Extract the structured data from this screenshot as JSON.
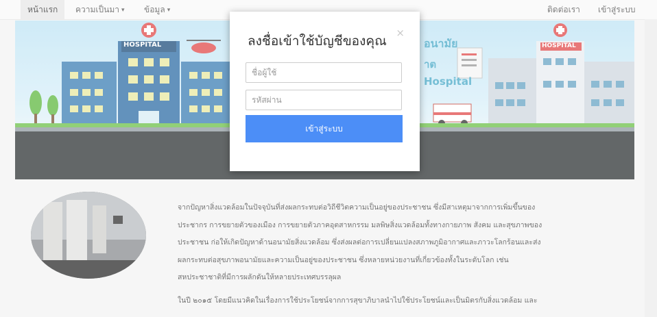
{
  "nav": {
    "items": [
      {
        "label": "หน้าแรก",
        "active": true
      },
      {
        "label": "ความเป็นมา",
        "dropdown": true
      },
      {
        "label": "ข้อมูล",
        "dropdown": true
      }
    ],
    "right": [
      "ติดต่อเรา",
      "เข้าสู่ระบบ"
    ]
  },
  "hero": {
    "hospital_sign_left": "HOSPITAL",
    "hospital_sign_right": "HOSPITAL",
    "text_1": "อนามัย",
    "text_2": "าต",
    "text_3": "Hospital"
  },
  "modal": {
    "title": "ลงชื่อเข้าใช้บัญชีของคุณ",
    "close": "×",
    "username_placeholder": "ชื่อผู้ใช้",
    "password_placeholder": "รหัสผ่าน",
    "login_button": "เข้าสู่ระบบ"
  },
  "article": {
    "lines": [
      "จากปัญหาสิ่งแวดล้อมในปัจจุบันที่ส่งผลกระทบต่อวิถีชีวิตความเป็นอยู่ของประชาชน ซึ่งมีสาเหตุมาจากการเพิ่มขึ้นของ",
      "ประชากร การขยายตัวของเมือง การขยายตัวภาคอุตสาหกรรม มลพิษสิ่งแวดล้อมทั้งทางกายภาพ สังคม และสุขภาพของ",
      "ประชาชน ก่อให้เกิดปัญหาด้านอนามัยสิ่งแวดล้อม ซึ่งส่งผลต่อการเปลี่ยนแปลงสภาพภูมิอากาศและภาวะโลกร้อนและส่ง",
      "ผลกระทบต่อสุขภาพอนามัยและความเป็นอยู่ของประชาชน ซึ่งหลายหน่วยงานที่เกี่ยวข้องทั้งในระดับโลก เช่น",
      "สหประชาชาติที่มีการผลักดันให้หลายประเทศบรรลุผล"
    ],
    "para2": "ในปี ๒๐๑๕ โดยมีแนวคิดในเรื่องการใช้ประโยชน์จากการสุขาภิบาลนำไปใช้ประโยชน์และเป็นมิตรกับสิ่งแวดล้อม และ"
  },
  "colors": {
    "accent": "#4c8ef7",
    "hero_dark": "#2f3436",
    "sky": "#cfeaf6",
    "grass": "#6cc04a"
  }
}
